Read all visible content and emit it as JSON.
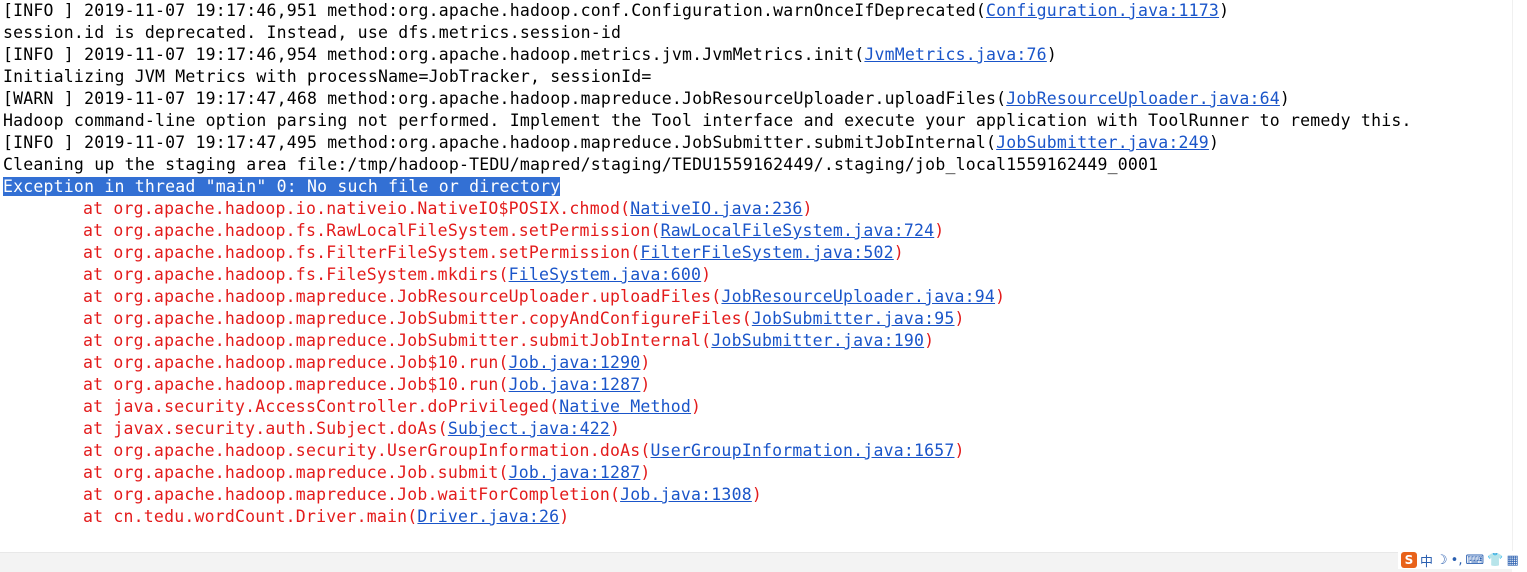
{
  "console": {
    "lines": [
      {
        "kind": "log",
        "text": "[INFO ] 2019-11-07 19:17:46,951 method:org.apache.hadoop.conf.Configuration.warnOnceIfDeprecated(",
        "link": "Configuration.java:1173",
        "tail": ")"
      },
      {
        "kind": "log",
        "text": "session.id is deprecated. Instead, use dfs.metrics.session-id"
      },
      {
        "kind": "log",
        "text": "[INFO ] 2019-11-07 19:17:46,954 method:org.apache.hadoop.metrics.jvm.JvmMetrics.init(",
        "link": "JvmMetrics.java:76",
        "tail": ")"
      },
      {
        "kind": "log",
        "text": "Initializing JVM Metrics with processName=JobTracker, sessionId="
      },
      {
        "kind": "log",
        "text": "[WARN ] 2019-11-07 19:17:47,468 method:org.apache.hadoop.mapreduce.JobResourceUploader.uploadFiles(",
        "link": "JobResourceUploader.java:64",
        "tail": ")"
      },
      {
        "kind": "log",
        "text": "Hadoop command-line option parsing not performed. Implement the Tool interface and execute your application with ToolRunner to remedy this."
      },
      {
        "kind": "log",
        "text": "[INFO ] 2019-11-07 19:17:47,495 method:org.apache.hadoop.mapreduce.JobSubmitter.submitJobInternal(",
        "link": "JobSubmitter.java:249",
        "tail": ")"
      },
      {
        "kind": "log",
        "text": "Cleaning up the staging area file:/tmp/hadoop-TEDU/mapred/staging/TEDU1559162449/.staging/job_local1559162449_0001"
      },
      {
        "kind": "selected",
        "text": "Exception in thread \"main\" 0: No such file or directory"
      },
      {
        "kind": "trace",
        "text": "at org.apache.hadoop.io.nativeio.NativeIO$POSIX.chmod(",
        "link": "NativeIO.java:236",
        "tail": ")"
      },
      {
        "kind": "trace",
        "text": "at org.apache.hadoop.fs.RawLocalFileSystem.setPermission(",
        "link": "RawLocalFileSystem.java:724",
        "tail": ")"
      },
      {
        "kind": "trace",
        "text": "at org.apache.hadoop.fs.FilterFileSystem.setPermission(",
        "link": "FilterFileSystem.java:502",
        "tail": ")"
      },
      {
        "kind": "trace",
        "text": "at org.apache.hadoop.fs.FileSystem.mkdirs(",
        "link": "FileSystem.java:600",
        "tail": ")"
      },
      {
        "kind": "trace",
        "text": "at org.apache.hadoop.mapreduce.JobResourceUploader.uploadFiles(",
        "link": "JobResourceUploader.java:94",
        "tail": ")"
      },
      {
        "kind": "trace",
        "text": "at org.apache.hadoop.mapreduce.JobSubmitter.copyAndConfigureFiles(",
        "link": "JobSubmitter.java:95",
        "tail": ")"
      },
      {
        "kind": "trace",
        "text": "at org.apache.hadoop.mapreduce.JobSubmitter.submitJobInternal(",
        "link": "JobSubmitter.java:190",
        "tail": ")"
      },
      {
        "kind": "trace",
        "text": "at org.apache.hadoop.mapreduce.Job$10.run(",
        "link": "Job.java:1290",
        "tail": ")"
      },
      {
        "kind": "trace",
        "text": "at org.apache.hadoop.mapreduce.Job$10.run(",
        "link": "Job.java:1287",
        "tail": ")"
      },
      {
        "kind": "trace",
        "text": "at java.security.AccessController.doPrivileged(",
        "link": "Native Method",
        "tail": ")"
      },
      {
        "kind": "trace",
        "text": "at javax.security.auth.Subject.doAs(",
        "link": "Subject.java:422",
        "tail": ")"
      },
      {
        "kind": "trace",
        "text": "at org.apache.hadoop.security.UserGroupInformation.doAs(",
        "link": "UserGroupInformation.java:1657",
        "tail": ")"
      },
      {
        "kind": "trace",
        "text": "at org.apache.hadoop.mapreduce.Job.submit(",
        "link": "Job.java:1287",
        "tail": ")"
      },
      {
        "kind": "trace",
        "text": "at org.apache.hadoop.mapreduce.Job.waitForCompletion(",
        "link": "Job.java:1308",
        "tail": ")"
      },
      {
        "kind": "trace",
        "text": "at cn.tedu.wordCount.Driver.main(",
        "link": "Driver.java:26",
        "tail": ")"
      }
    ]
  },
  "ime_tray": {
    "logo": "S",
    "lang": "中",
    "icons": [
      "moon-icon",
      "dot-icon",
      "keyboard-icon",
      "shirt-icon",
      "grid-icon"
    ]
  },
  "colors": {
    "error_text": "#e31b1b",
    "link": "#1a55c9",
    "selection_bg": "#3370d4",
    "normal_text": "#000000"
  }
}
